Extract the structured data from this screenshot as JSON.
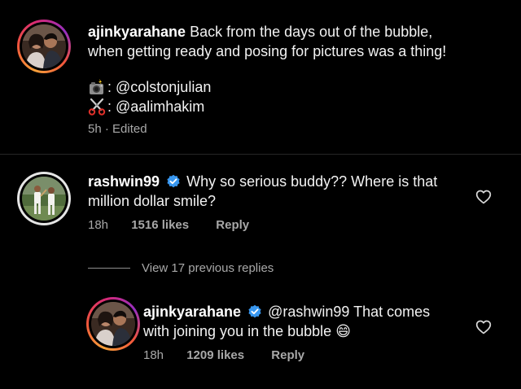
{
  "post": {
    "username": "ajinkyarahane",
    "caption_line1": "Back from the days out of the bubble,",
    "caption_line2": "when getting ready and posing for pictures was a thing!",
    "photo_credit": ": @colstonjulian",
    "style_credit": ": @aalimhakim",
    "time": "5h",
    "separator": "·",
    "edited": "Edited",
    "camera_icon": "camera-flash-icon",
    "scissors_icon": "scissors-icon"
  },
  "comments": [
    {
      "username": "rashwin99",
      "verified": true,
      "text_line1": "Why so serious buddy?? Where is that",
      "text_line2": "million dollar smile?",
      "time": "18h",
      "likes": "1516 likes",
      "reply": "Reply"
    }
  ],
  "view_replies": "View 17 previous replies",
  "replies": [
    {
      "username": "ajinkyarahane",
      "verified": true,
      "text_line1": "@rashwin99 That comes",
      "text_line2": "with joining you in the bubble",
      "emoji": "😄",
      "time": "18h",
      "likes": "1209 likes",
      "reply": "Reply"
    }
  ],
  "colors": {
    "background": "#000000",
    "text": "#f2f2f2",
    "secondary": "#a8a8a8",
    "verified": "#3897f0",
    "story_ring": "#d62976"
  }
}
